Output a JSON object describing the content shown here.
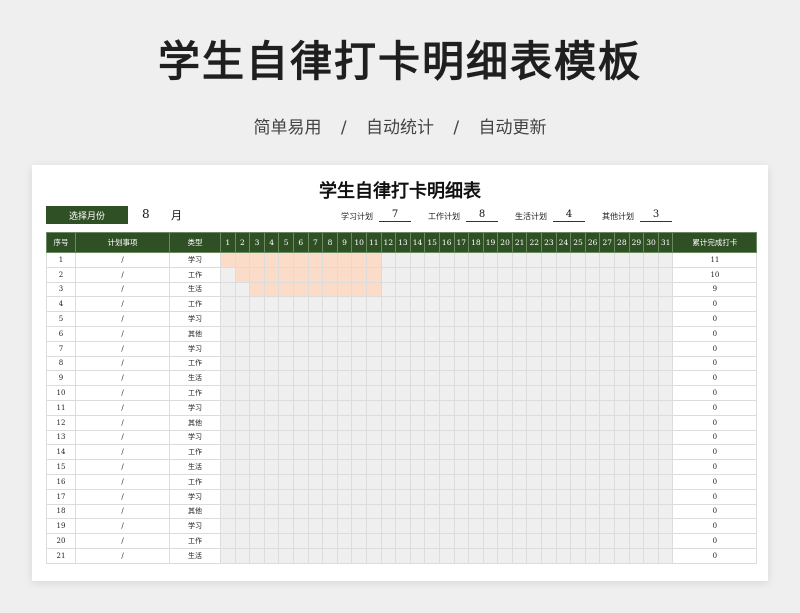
{
  "page": {
    "title": "学生自律打卡明细表模板",
    "subtitle": "简单易用   /   自动统计   /   自动更新"
  },
  "sheet": {
    "title": "学生自律打卡明细表",
    "month_button": "选择月份",
    "month_value": "8",
    "month_unit": "月",
    "plans": [
      {
        "label": "学习计划",
        "value": "7"
      },
      {
        "label": "工作计划",
        "value": "8"
      },
      {
        "label": "生活计划",
        "value": "4"
      },
      {
        "label": "其他计划",
        "value": "3"
      }
    ],
    "headers": {
      "seq": "序号",
      "item": "计划事项",
      "type": "类型",
      "total": "累计完成打卡"
    },
    "days": [
      "1",
      "2",
      "3",
      "4",
      "5",
      "6",
      "7",
      "8",
      "9",
      "10",
      "11",
      "12",
      "13",
      "14",
      "15",
      "16",
      "17",
      "18",
      "19",
      "20",
      "21",
      "22",
      "23",
      "24",
      "25",
      "26",
      "27",
      "28",
      "29",
      "30",
      "31"
    ],
    "rows": [
      {
        "seq": "1",
        "item": "/",
        "type": "学习",
        "total": "11",
        "done": 11,
        "done_start": 1
      },
      {
        "seq": "2",
        "item": "/",
        "type": "工作",
        "total": "10",
        "done": 10,
        "done_start": 2
      },
      {
        "seq": "3",
        "item": "/",
        "type": "生活",
        "total": "9",
        "done": 9,
        "done_start": 3
      },
      {
        "seq": "4",
        "item": "/",
        "type": "工作",
        "total": "0",
        "done": 0,
        "done_start": 1
      },
      {
        "seq": "5",
        "item": "/",
        "type": "学习",
        "total": "0",
        "done": 0,
        "done_start": 1
      },
      {
        "seq": "6",
        "item": "/",
        "type": "其他",
        "total": "0",
        "done": 0,
        "done_start": 1
      },
      {
        "seq": "7",
        "item": "/",
        "type": "学习",
        "total": "0",
        "done": 0,
        "done_start": 1
      },
      {
        "seq": "8",
        "item": "/",
        "type": "工作",
        "total": "0",
        "done": 0,
        "done_start": 1
      },
      {
        "seq": "9",
        "item": "/",
        "type": "生活",
        "total": "0",
        "done": 0,
        "done_start": 1
      },
      {
        "seq": "10",
        "item": "/",
        "type": "工作",
        "total": "0",
        "done": 0,
        "done_start": 1
      },
      {
        "seq": "11",
        "item": "/",
        "type": "学习",
        "total": "0",
        "done": 0,
        "done_start": 1
      },
      {
        "seq": "12",
        "item": "/",
        "type": "其他",
        "total": "0",
        "done": 0,
        "done_start": 1
      },
      {
        "seq": "13",
        "item": "/",
        "type": "学习",
        "total": "0",
        "done": 0,
        "done_start": 1
      },
      {
        "seq": "14",
        "item": "/",
        "type": "工作",
        "total": "0",
        "done": 0,
        "done_start": 1
      },
      {
        "seq": "15",
        "item": "/",
        "type": "生活",
        "total": "0",
        "done": 0,
        "done_start": 1
      },
      {
        "seq": "16",
        "item": "/",
        "type": "工作",
        "total": "0",
        "done": 0,
        "done_start": 1
      },
      {
        "seq": "17",
        "item": "/",
        "type": "学习",
        "total": "0",
        "done": 0,
        "done_start": 1
      },
      {
        "seq": "18",
        "item": "/",
        "type": "其他",
        "total": "0",
        "done": 0,
        "done_start": 1
      },
      {
        "seq": "19",
        "item": "/",
        "type": "学习",
        "total": "0",
        "done": 0,
        "done_start": 1
      },
      {
        "seq": "20",
        "item": "/",
        "type": "工作",
        "total": "0",
        "done": 0,
        "done_start": 1
      },
      {
        "seq": "21",
        "item": "/",
        "type": "生活",
        "total": "0",
        "done": 0,
        "done_start": 1
      }
    ],
    "colors": {
      "header_green": "#2f5024",
      "done_cell": "#fadcc9",
      "empty_cell": "#efefef"
    }
  }
}
